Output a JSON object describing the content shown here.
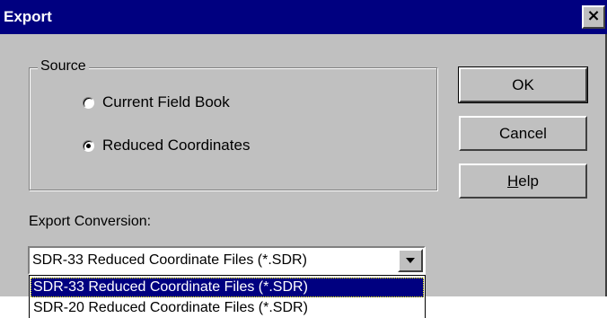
{
  "window": {
    "title": "Export",
    "close_label": "×"
  },
  "source_group": {
    "legend": "Source",
    "options": [
      {
        "label": "Current Field Book",
        "checked": false
      },
      {
        "label": "Reduced Coordinates",
        "checked": true
      }
    ]
  },
  "buttons": {
    "ok": "OK",
    "cancel": "Cancel",
    "help_mnemonic": "H",
    "help_rest": "elp"
  },
  "export_conversion": {
    "label": "Export Conversion:",
    "selected_value": "SDR-33 Reduced Coordinate Files (*.SDR)",
    "options": [
      {
        "label": "SDR-33 Reduced Coordinate Files (*.SDR)",
        "highlighted": true
      },
      {
        "label": "SDR-20 Reduced Coordinate Files (*.SDR)",
        "highlighted": false
      }
    ]
  },
  "colors": {
    "titlebar": "#000080",
    "dialog_face": "#c0c0c0",
    "selection": "#000080"
  }
}
